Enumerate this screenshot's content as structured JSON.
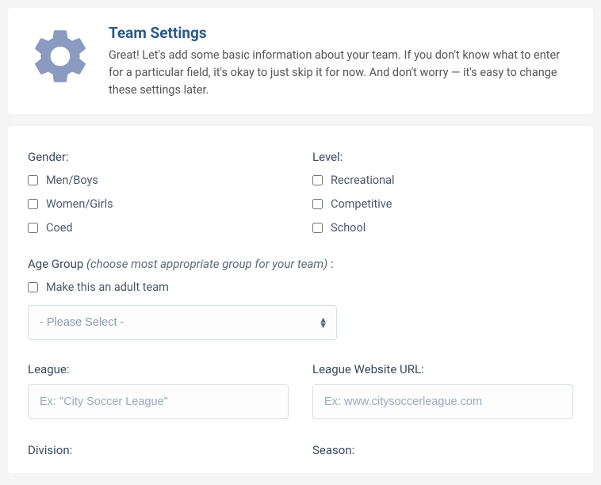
{
  "header": {
    "title": "Team Settings",
    "description": "Great! Let's add some basic information about your team. If you don't know what to enter for a particular field, it's okay to just skip it for now. And don't worry — it's easy to change these settings later."
  },
  "form": {
    "gender": {
      "label": "Gender:",
      "options": [
        "Men/Boys",
        "Women/Girls",
        "Coed"
      ]
    },
    "level": {
      "label": "Level:",
      "options": [
        "Recreational",
        "Competitive",
        "School"
      ]
    },
    "ageGroup": {
      "label": "Age Group ",
      "hint": "(choose most appropriate group for your team)",
      "colon": " :",
      "adultCheckbox": "Make this an adult team",
      "selectPlaceholder": "- Please Select -"
    },
    "league": {
      "label": "League:",
      "placeholder": "Ex: \"City Soccer League\""
    },
    "leagueUrl": {
      "label": "League Website URL:",
      "placeholder": "Ex: www.citysoccerleague.com"
    },
    "division": {
      "label": "Division:"
    },
    "season": {
      "label": "Season:"
    }
  }
}
